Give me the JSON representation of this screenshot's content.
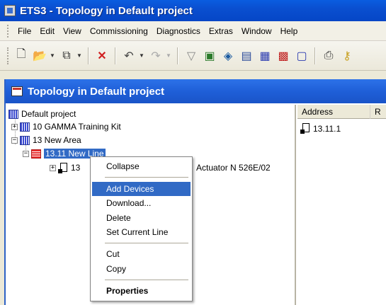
{
  "app": {
    "title": "ETS3 - Topology in Default project"
  },
  "menubar": {
    "items": [
      "File",
      "Edit",
      "View",
      "Commissioning",
      "Diagnostics",
      "Extras",
      "Window",
      "Help"
    ]
  },
  "toolbar": {
    "icons": [
      "new-document-icon",
      "open-folder-icon",
      "copy-icon",
      "delete-icon",
      "undo-icon",
      "redo-icon",
      "filter-icon",
      "properties-icon",
      "find-icon",
      "settings-icon",
      "grid-icon",
      "topology-icon",
      "window-icon",
      "print-icon"
    ]
  },
  "document": {
    "title": "Topology in Default project"
  },
  "tree": {
    "root": "Default project",
    "n1": "10 GAMMA Training Kit",
    "n2": "13 New Area",
    "n3": "13.11 New Line",
    "n4_prefix": "13",
    "n4_suffix": "Actuator N 526E/02"
  },
  "list": {
    "columns": [
      "Address",
      "R"
    ],
    "rows": [
      "13.11.1"
    ]
  },
  "context_menu": {
    "collapse": "Collapse",
    "add_devices": "Add Devices",
    "download": "Download...",
    "delete": "Delete",
    "set_current_line": "Set Current Line",
    "cut": "Cut",
    "copy": "Copy",
    "properties": "Properties"
  },
  "colors": {
    "title_bar": "#0546c6",
    "selection": "#316ac5"
  }
}
